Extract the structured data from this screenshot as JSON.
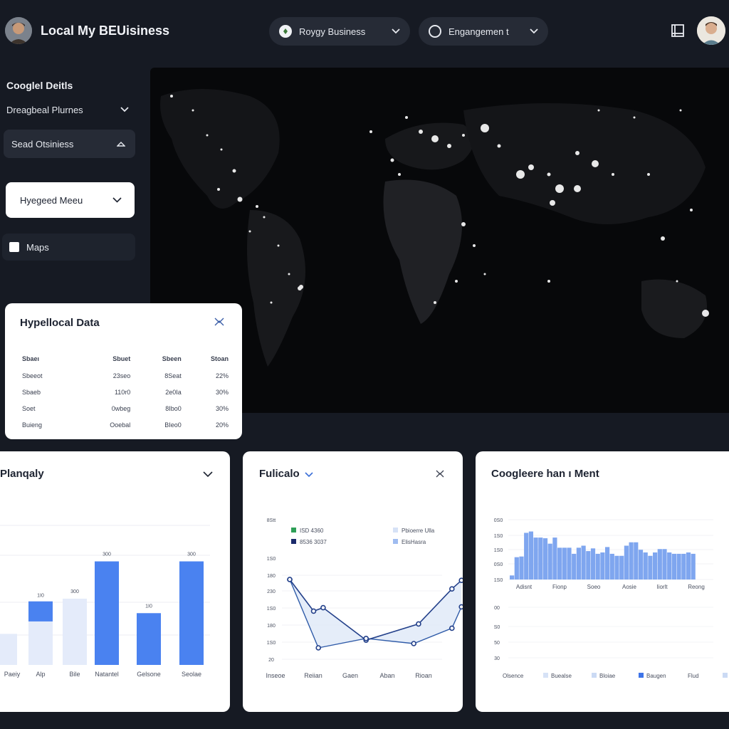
{
  "header": {
    "app_title": "Local My BEUisiness",
    "business_pill": {
      "label": "Roygy Business",
      "icon": "leaf-icon"
    },
    "engagement_pill": {
      "label": "Engangemen t",
      "icon": "ring-icon"
    },
    "book_icon": "book-icon"
  },
  "sidebar": {
    "heading": "Cooglel Deitls",
    "dropdown": "Dreagbeal Plurnes",
    "item": "Sead Otsiniess",
    "select": "Hyegeed Meeu",
    "checkbox_label": "Maps"
  },
  "data_card": {
    "title": "Hypellocal Data",
    "columns": [
      "Sbaeı",
      "Sbuet",
      "Sbeen",
      "Stoan"
    ],
    "rows": [
      [
        "Sbeeot",
        "23seo",
        "8Seat",
        "22%"
      ],
      [
        "Sbaeb",
        "110r0",
        "2e0Ia",
        "30%"
      ],
      [
        "Soet",
        "0wbeg",
        "8Ibo0",
        "30%"
      ],
      [
        "Buieng",
        "Ooebal",
        "BIeo0",
        "20%"
      ]
    ]
  },
  "cards": {
    "bar": {
      "title": "Planqaly"
    },
    "line": {
      "title": "Fulicalo"
    },
    "hist": {
      "title": "Coogleere han ı Ment"
    }
  },
  "chart_data": [
    {
      "type": "bar",
      "categories": [
        "Paeiy",
        "Alp",
        "Bile",
        "Natantel",
        "Gelsone",
        "Seolae"
      ],
      "series": [
        {
          "values": [
            30,
            60,
            64,
            100,
            50,
            100
          ],
          "color": "#4a82f0"
        },
        {
          "values": [
            30,
            42,
            64,
            0,
            0,
            0
          ],
          "color": "#e4ebfa"
        }
      ],
      "data_labels": [
        "",
        "1I0",
        "300",
        "300",
        "1I0",
        "300"
      ],
      "ylim": [
        0,
        110
      ]
    },
    {
      "type": "line",
      "x": [
        "Inseoe",
        "Reiian",
        "Gaen",
        "Aban",
        "Rioan"
      ],
      "y_tick_labels": [
        "8Stt",
        "1S0",
        "180",
        "230",
        "1S0",
        "180",
        "1S0",
        "20"
      ],
      "legend": [
        {
          "label": "ISD 4360",
          "color": "#2e9f57"
        },
        {
          "label": "8536 3037",
          "color": "#1b2a6b"
        },
        {
          "label": "Pbioerre Ulla",
          "color": "#d6e2f6"
        },
        {
          "label": "ElisHasra",
          "color": "#9fbcf0"
        }
      ],
      "series": [
        {
          "points": [
            [
              0,
              85
            ],
            [
              0.5,
              48
            ],
            [
              0.7,
              52
            ],
            [
              1.6,
              14
            ],
            [
              2.7,
              33
            ],
            [
              3.4,
              74
            ],
            [
              3.6,
              84
            ]
          ]
        },
        {
          "points": [
            [
              0,
              85
            ],
            [
              0.6,
              5
            ],
            [
              1.6,
              16
            ],
            [
              2.6,
              10
            ],
            [
              3.4,
              28
            ],
            [
              3.6,
              53
            ]
          ]
        }
      ],
      "ylim": [
        0,
        100
      ]
    },
    {
      "type": "bar",
      "categories": [
        "Adisnt",
        "Fionp",
        "Soeo",
        "Aosie",
        "Iiorlt",
        "Reong"
      ],
      "y_tick_labels": [
        "0S0",
        "1S0",
        "1S0",
        "0S0",
        "1S0",
        "1S0"
      ],
      "values": [
        6,
        33,
        34,
        69,
        71,
        62,
        62,
        61,
        53,
        62,
        47,
        47,
        47,
        38,
        47,
        50,
        42,
        46,
        38,
        40,
        48,
        38,
        35,
        35,
        50,
        55,
        55,
        44,
        40,
        35,
        40,
        45,
        45,
        40,
        38,
        38,
        38,
        40,
        38
      ],
      "ylim": [
        0,
        80
      ],
      "lower_y_tick_labels": [
        "00",
        "S0",
        "50",
        "30",
        "30"
      ],
      "legend": [
        {
          "label": "Olsence",
          "color": ""
        },
        {
          "label": "Buealse",
          "color": "#d6e2f6"
        },
        {
          "label": "Bloiae",
          "color": "#cbdaf4"
        },
        {
          "label": "Baugen",
          "color": "#3e74e8"
        },
        {
          "label": "Flud",
          "color": ""
        }
      ]
    }
  ]
}
